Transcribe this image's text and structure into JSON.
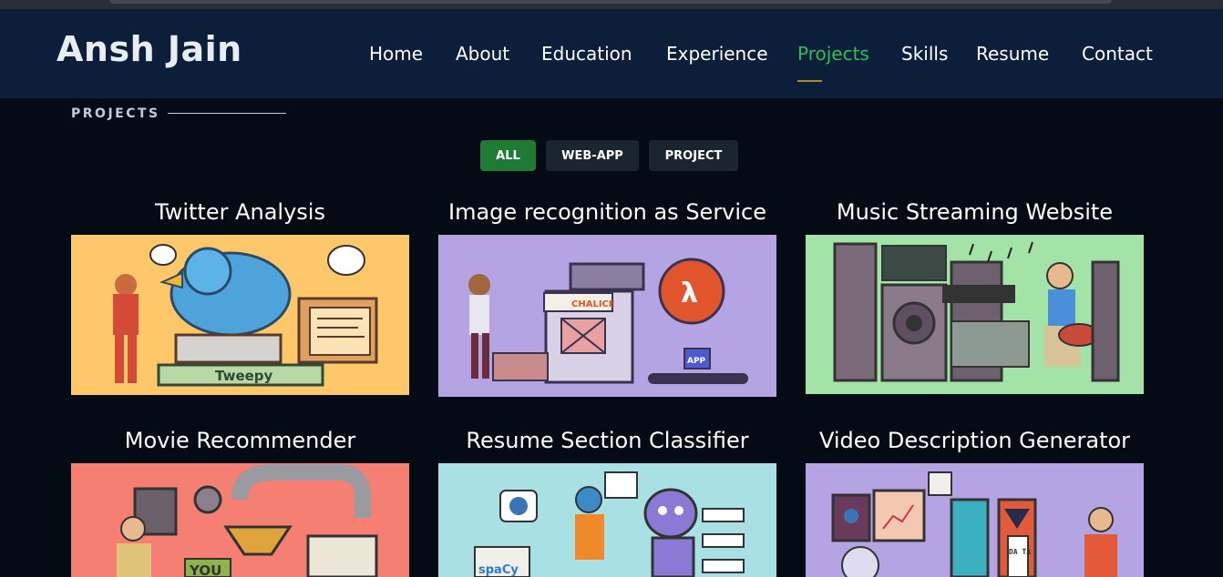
{
  "header": {
    "brand": "Ansh Jain",
    "nav": [
      "Home",
      "About",
      "Education",
      "Experience",
      "Projects",
      "Skills",
      "Resume",
      "Contact"
    ],
    "active_nav": "Projects"
  },
  "section": {
    "title": "PROJECTS"
  },
  "filters": [
    "ALL",
    "WEB-APP",
    "PROJECT"
  ],
  "active_filter": "ALL",
  "projects": [
    {
      "title": "Twitter Analysis",
      "art_text": "Tweepy",
      "bg": "#fdc76a"
    },
    {
      "title": "Image recognition as Service",
      "art_text": "CHALICE",
      "art_text2": "APP",
      "bg": "#b4a4e4"
    },
    {
      "title": "Music Streaming Website",
      "bg": "#a3e3a8"
    },
    {
      "title": "Movie Recommender",
      "art_text": "YOU",
      "bg": "#f57f72"
    },
    {
      "title": "Resume Section Classifier",
      "art_text": "spaCy",
      "bg": "#a8e0e4"
    },
    {
      "title": "Video Description Generator",
      "art_text": "DA TA",
      "bg": "#b4a4e4"
    }
  ],
  "colors": {
    "navbar_bg": "#0b1f3b",
    "page_bg": "#040b14",
    "accent_green": "#2fbf57",
    "filter_active": "#1f7a34",
    "filter_bg": "#1b2530"
  }
}
